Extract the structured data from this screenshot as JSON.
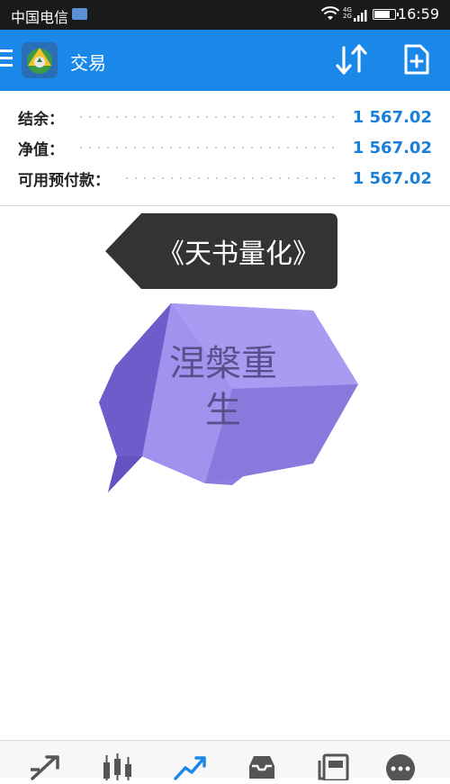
{
  "status_bar": {
    "carrier": "中国电信",
    "network_top": "4G",
    "network_bottom": "2G",
    "battery_percent": 85,
    "time": "16:59"
  },
  "app_bar": {
    "title": "交易",
    "icons": [
      "menu-icon",
      "app-logo",
      "sort-icon",
      "new-order-icon"
    ]
  },
  "balances": [
    {
      "label": "结余：",
      "value": "1 567.02"
    },
    {
      "label": "净值：",
      "value": "1 567.02"
    },
    {
      "label": "可用预付款：",
      "value": "1 567.02"
    }
  ],
  "overlay": {
    "tooltip_text": "《天书量化》",
    "tooltip_color": "#333333",
    "bubble_line1": "涅槃重",
    "bubble_line2": "生"
  },
  "bottom_nav": {
    "items": [
      "quotes-icon",
      "chart-icon",
      "trade-icon",
      "history-icon",
      "news-icon",
      "messages-icon"
    ],
    "active": "trade-icon"
  },
  "colors": {
    "accent": "#1a88e8",
    "value_blue": "#1a7fd8",
    "status_bar": "#1a1a1a"
  }
}
